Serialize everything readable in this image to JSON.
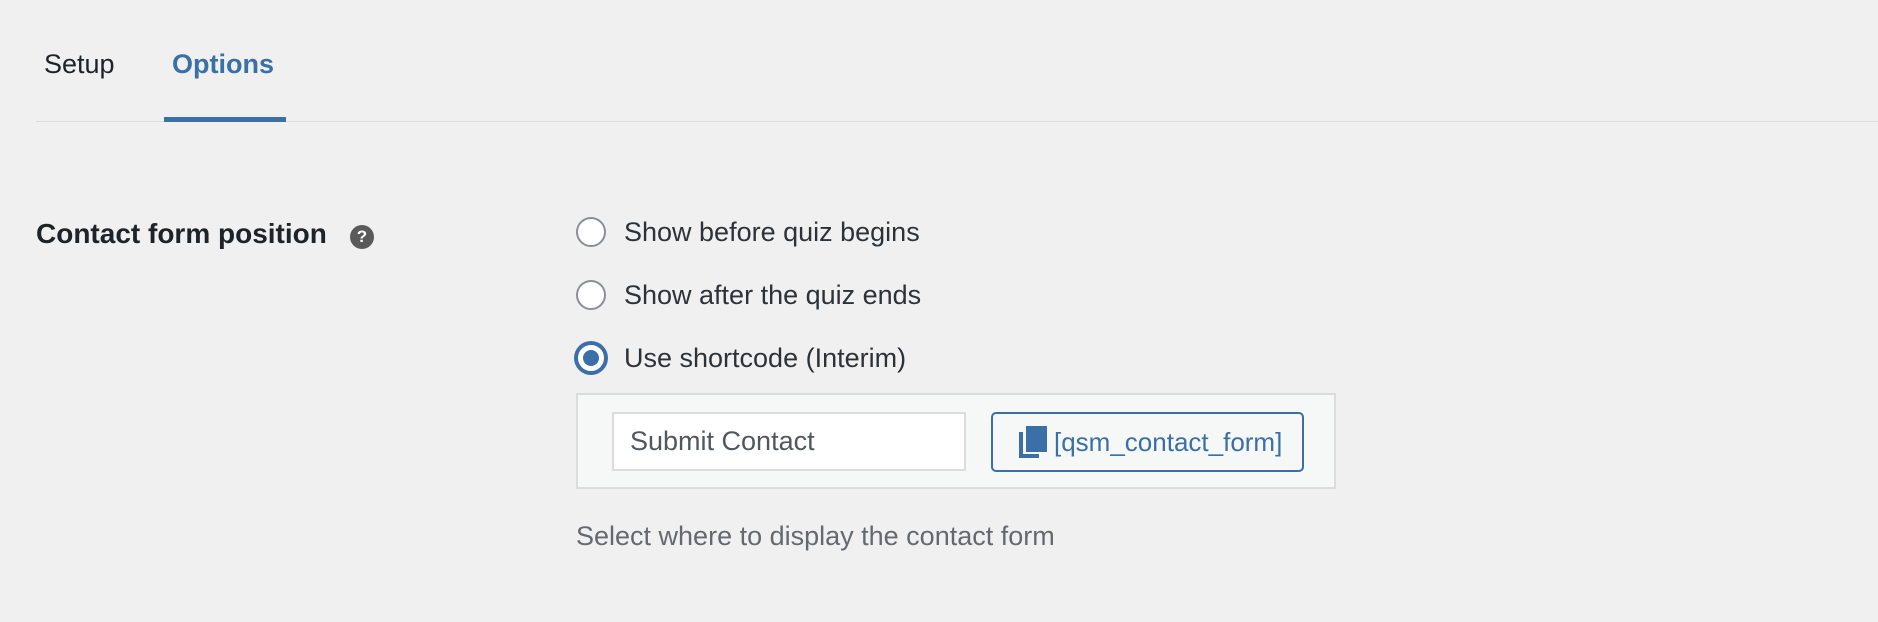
{
  "tabs": [
    {
      "label": "Setup",
      "active": false
    },
    {
      "label": "Options",
      "active": true
    }
  ],
  "contact_form_position": {
    "label": "Contact form position",
    "help_icon": "question-circle-icon",
    "help_symbol": "?",
    "options": [
      {
        "label": "Show before quiz begins",
        "checked": false
      },
      {
        "label": "Show after the quiz ends",
        "checked": false
      },
      {
        "label": "Use shortcode (Interim)",
        "checked": true
      }
    ],
    "shortcode": {
      "input_value": "Submit Contact",
      "copy_icon": "copy-icon",
      "copy_button_label": "[qsm_contact_form]"
    },
    "description": "Select where to display the contact form"
  },
  "colors": {
    "accent": "#3a6fa8",
    "background": "#f0f0f1",
    "text": "#1d2327",
    "muted_text": "#646970"
  }
}
